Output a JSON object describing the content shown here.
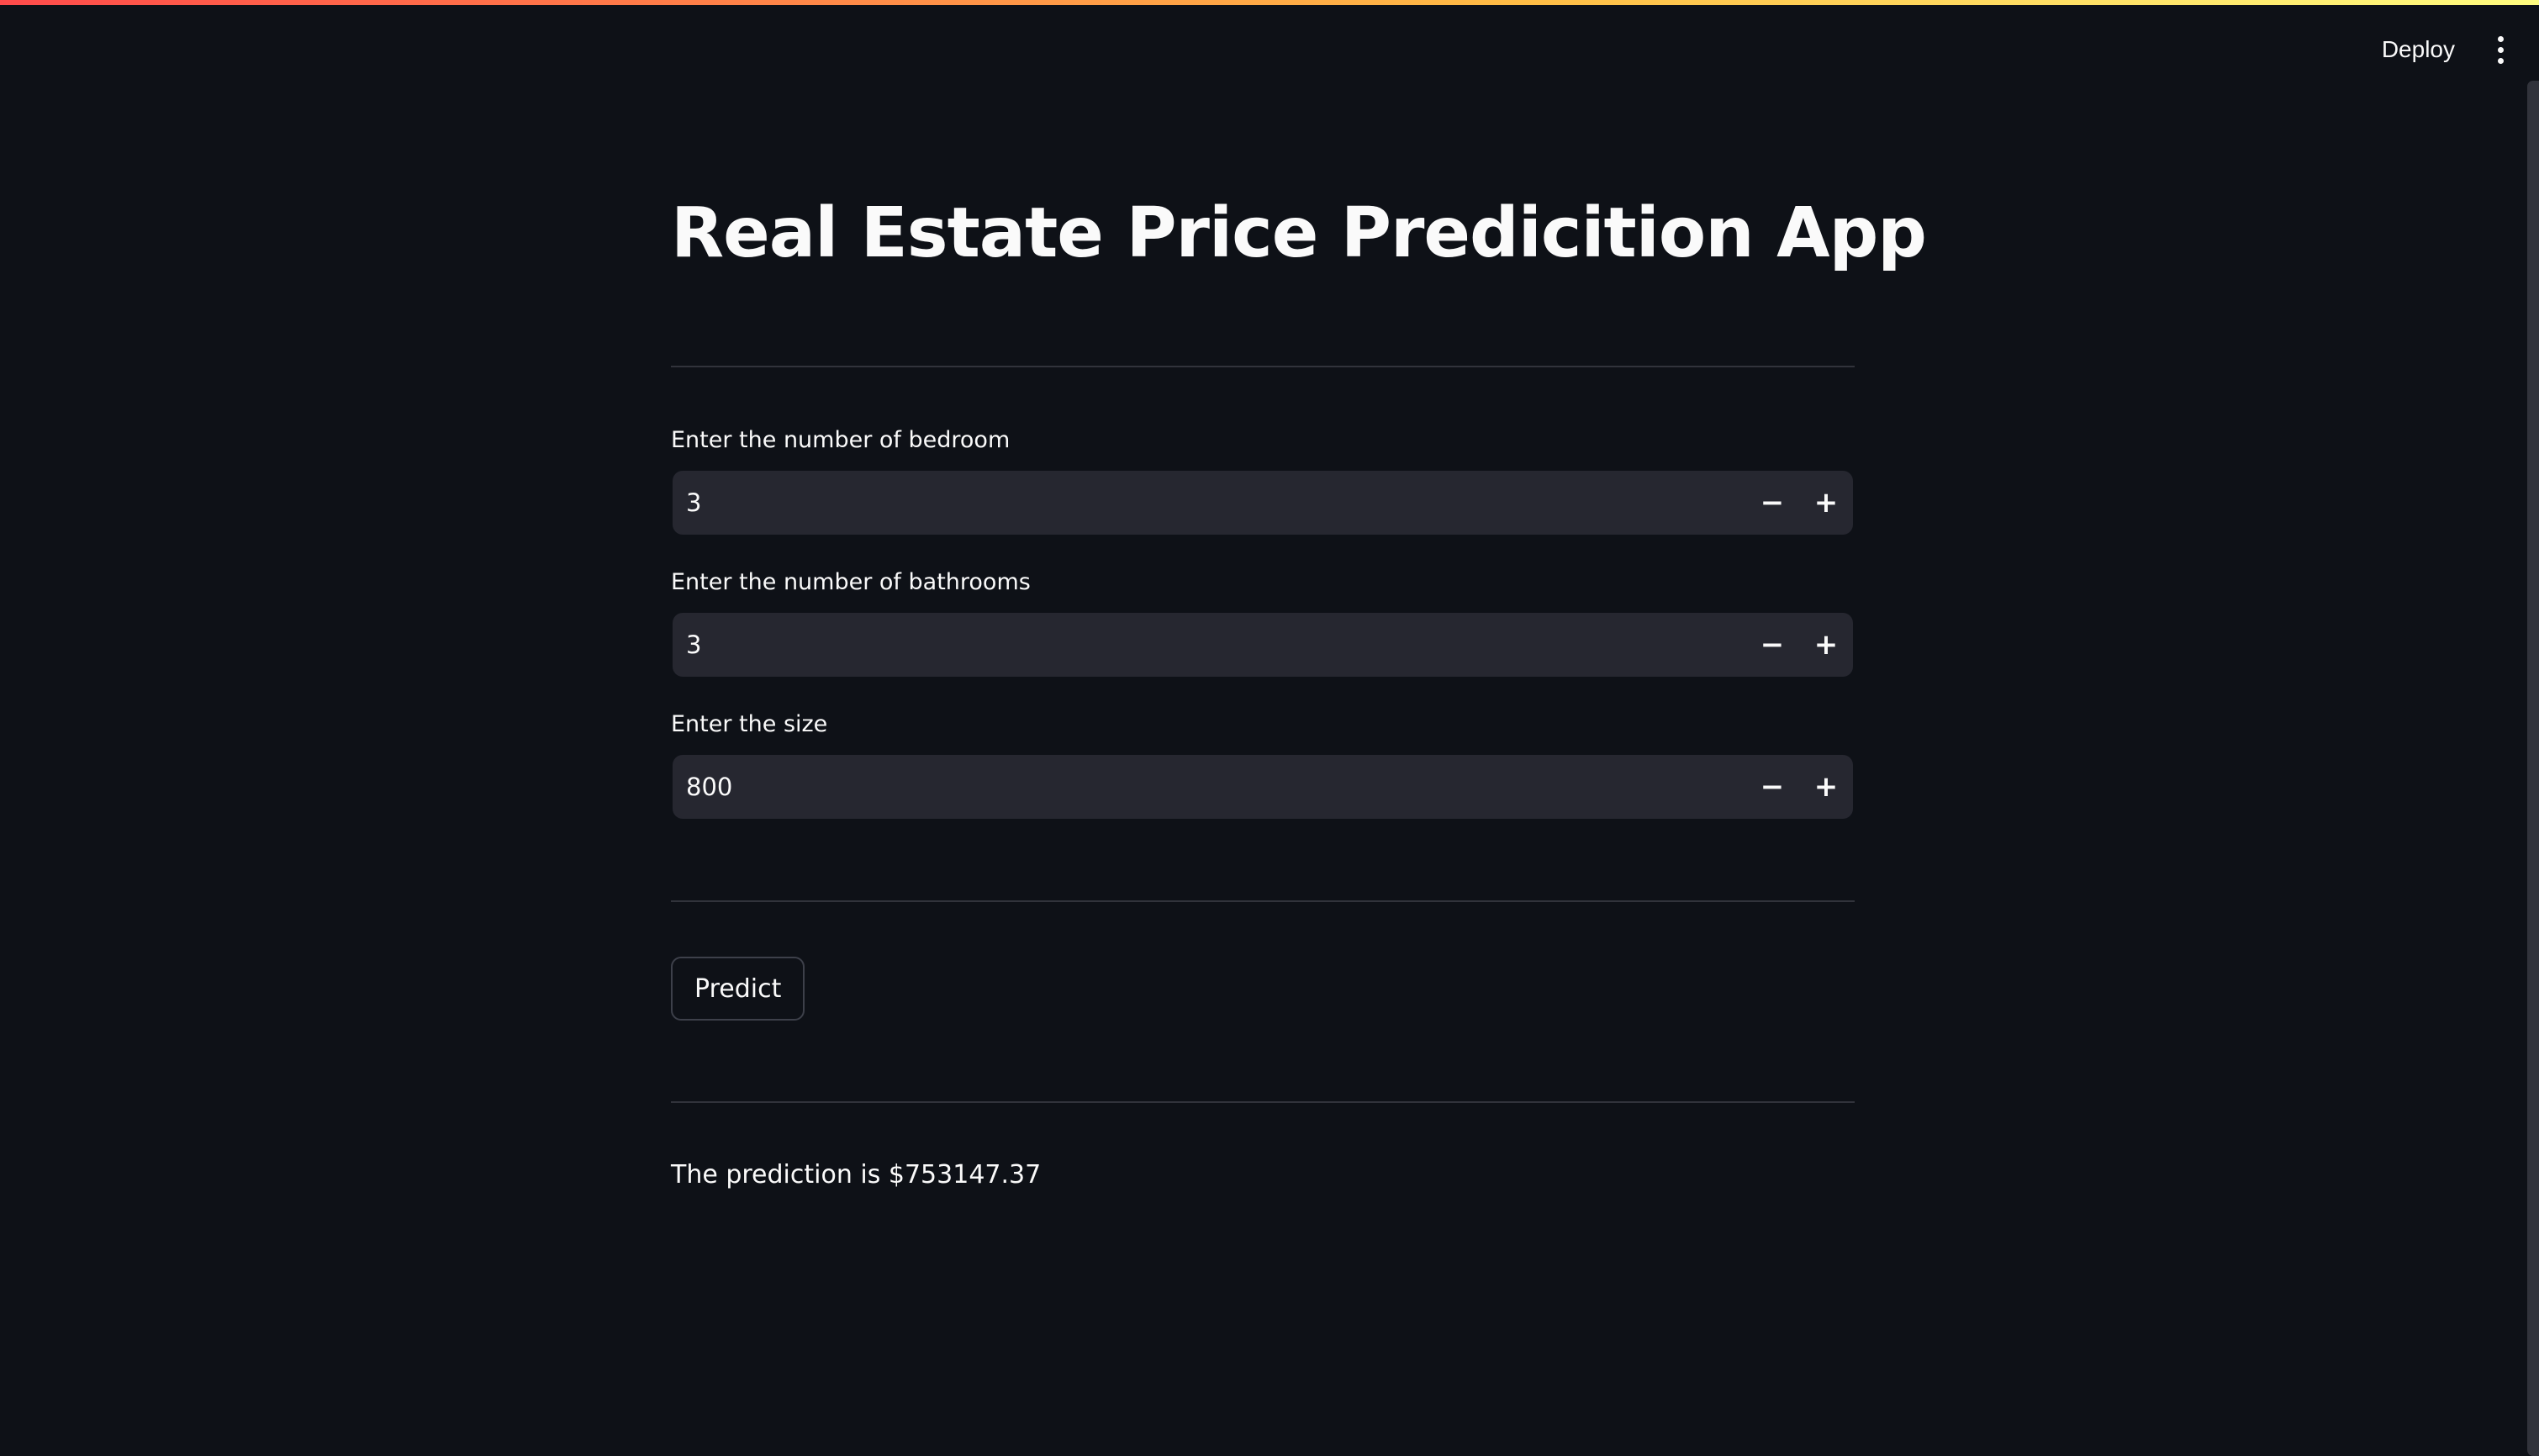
{
  "header": {
    "deploy_label": "Deploy"
  },
  "main": {
    "title": "Real Estate Price Predicition App",
    "inputs": [
      {
        "label": "Enter the number of bedroom",
        "value": "3"
      },
      {
        "label": "Enter the number of bathrooms",
        "value": "3"
      },
      {
        "label": "Enter the size",
        "value": "800"
      }
    ],
    "minus_symbol": "−",
    "plus_symbol": "+",
    "predict_label": "Predict",
    "result_text": "The prediction is $753147.37"
  },
  "colors": {
    "background": "#0e1117",
    "input_background": "#262730",
    "text": "#fafafa",
    "accent_gradient_start": "#ff4b4b",
    "accent_gradient_end": "#fffd80"
  }
}
